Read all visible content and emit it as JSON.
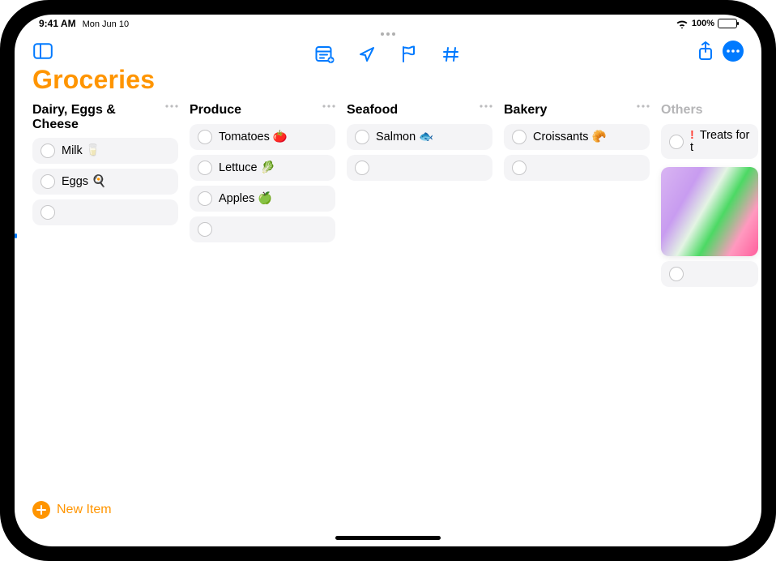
{
  "status": {
    "time": "9:41 AM",
    "date": "Mon Jun 10",
    "batteryPct": "100%"
  },
  "title": "Groceries",
  "newItemLabel": "New Item",
  "sections": [
    {
      "title": "Dairy, Eggs & Cheese",
      "items": [
        {
          "text": "Milk 🥛"
        },
        {
          "text": "Eggs 🍳"
        },
        {
          "empty": true
        }
      ]
    },
    {
      "title": "Produce",
      "items": [
        {
          "text": "Tomatoes 🍅"
        },
        {
          "text": "Lettuce 🥬"
        },
        {
          "text": "Apples 🍏"
        },
        {
          "empty": true
        }
      ]
    },
    {
      "title": "Seafood",
      "items": [
        {
          "text": "Salmon 🐟"
        },
        {
          "empty": true
        }
      ]
    },
    {
      "title": "Bakery",
      "items": [
        {
          "text": "Croissants 🥐"
        },
        {
          "empty": true
        }
      ]
    },
    {
      "title": "Others",
      "dimmed": true,
      "noMore": true,
      "items": [
        {
          "text": "Treats for t",
          "priority": "!"
        },
        {
          "thumb": true
        },
        {
          "empty": true
        }
      ]
    }
  ]
}
